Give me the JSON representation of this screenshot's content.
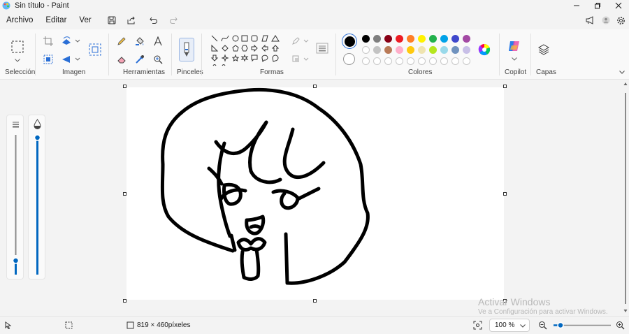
{
  "window": {
    "title": "Sin título - Paint"
  },
  "menu": {
    "file": "Archivo",
    "edit": "Editar",
    "view": "Ver"
  },
  "ribbon": {
    "groups": {
      "selection": "Selección",
      "image": "Imagen",
      "tools": "Herramientas",
      "brushes": "Pinceles",
      "shapes": "Formas",
      "colors": "Colores",
      "copilot": "Copilot",
      "layers": "Capas"
    },
    "palette": {
      "row1": [
        "#000000",
        "#7f7f7f",
        "#880015",
        "#ed1c24",
        "#ff7f27",
        "#fff200",
        "#22b14c",
        "#00a2e8",
        "#3f48cc",
        "#a349a4"
      ],
      "row2": [
        "#ffffff",
        "#c3c3c3",
        "#b97a57",
        "#ffaec9",
        "#ffc90e",
        "#efe4b0",
        "#b5e61d",
        "#99d9ea",
        "#7092be",
        "#c8bfe7"
      ]
    },
    "primary_color": "#000000",
    "secondary_color": "#ffffff"
  },
  "status": {
    "canvas_size": "819 × 460píxeles",
    "zoom": "100 %"
  },
  "watermark": {
    "line1": "Activar Windows",
    "line2": "Ve a Configuración para activar Windows."
  },
  "icons": {
    "app": "paint-app-icon",
    "save": "save-icon",
    "share": "share-icon",
    "undo": "undo-icon",
    "redo": "redo-icon",
    "select": "rectangle-select-icon",
    "crop": "crop-icon",
    "rotate": "rotate-icon",
    "flip": "flip-icon",
    "resize": "resize-icon",
    "pencil": "pencil-icon",
    "fill": "fill-icon",
    "text": "text-icon",
    "eraser": "eraser-icon",
    "picker": "color-picker-icon",
    "magnifier": "magnifier-icon",
    "brush": "brush-icon",
    "edit_colors": "edit-colors-icon",
    "copilot": "copilot-icon",
    "layers": "layers-icon"
  }
}
